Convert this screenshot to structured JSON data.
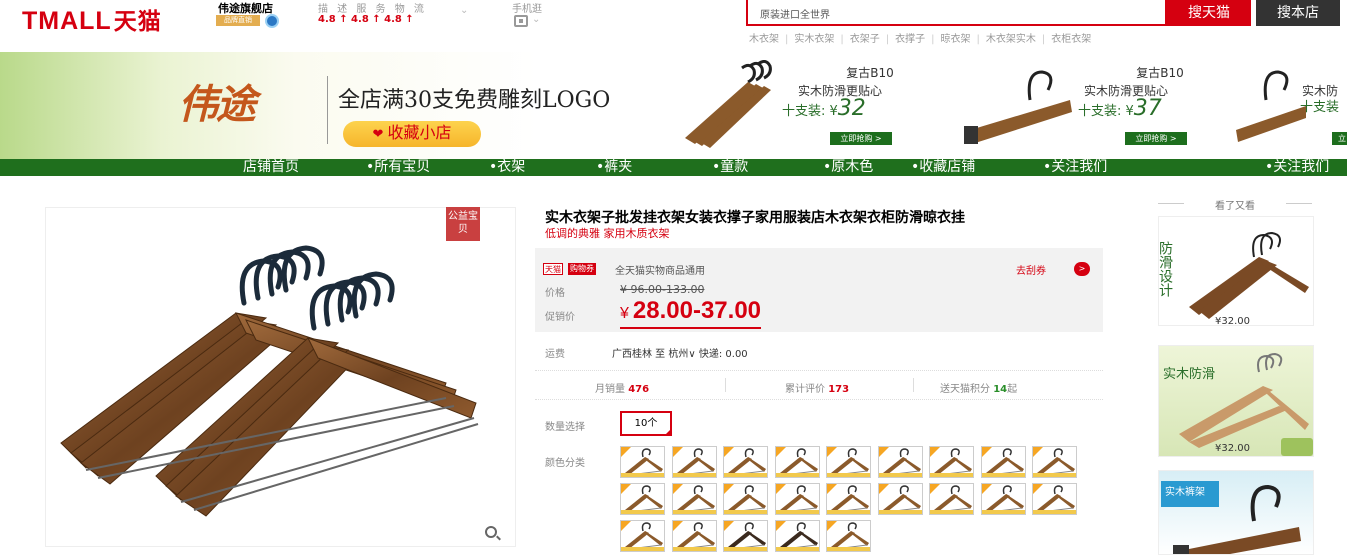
{
  "header": {
    "logo_latin": "TMALL",
    "logo_cn": "天猫",
    "shop_name": "伟途旗舰店",
    "shop_badge": "品牌直销",
    "rating_labels": "描 述  服 务  物 流",
    "rating_values": "4.8 ↑  4.8 ↑  4.8 ↑",
    "mobile_label": "手机逛",
    "search_placeholder": "原装进口全世界",
    "search_tmall_label": "搜天猫",
    "search_shop_label": "搜本店",
    "hot_words": [
      "木衣架",
      "实木衣架",
      "衣架子",
      "衣撑子",
      "晾衣架",
      "木衣架实木",
      "衣柜衣架"
    ]
  },
  "banner": {
    "brand": "伟途",
    "promo_text": "全店满30支免费雕刻LOGO",
    "favorite_label": "收藏小店",
    "cards": [
      {
        "title": "复古B10",
        "subtitle": "实木防滑更贴心",
        "price_prefix": "十支装: ¥",
        "price": "32",
        "buy": "立即抢购 >"
      },
      {
        "title": "复古B10",
        "subtitle": "实木防滑更贴心",
        "price_prefix": "十支装: ¥",
        "price": "37",
        "buy": "立即抢购 >"
      },
      {
        "title": "复",
        "subtitle": "实木防",
        "price_prefix": "十支装",
        "price": "",
        "buy": "立"
      }
    ]
  },
  "nav": {
    "items": [
      "店铺首页",
      "•所有宝贝",
      "•衣架",
      "•裤夹",
      "•童款",
      "•原木色",
      "•收藏店铺",
      "•关注我们",
      "•关注我们"
    ]
  },
  "product": {
    "welfare_tag": "公益宝贝",
    "title": "实木衣架子批发挂衣架女装衣撑子家用服装店木衣架衣柜防滑晾衣挂",
    "subtitle": "低调的典雅 家用木质衣架",
    "tag_tmall": "天猫",
    "tag_coupon": "购物券",
    "coupon_text": "全天猫实物商品通用",
    "coupon_link": "去刮券",
    "price_label": "价格",
    "original_price": "¥ 96.00-133.00",
    "promo_label": "促销价",
    "currency": "¥",
    "promo_price": "28.00-37.00",
    "ship_label": "运费",
    "ship_value": "广西桂林 至 杭州∨ 快递: 0.00",
    "monthly_sales_label": "月销量",
    "monthly_sales": "476",
    "reviews_label": "累计评价",
    "reviews": "173",
    "points_label": "送天猫积分",
    "points": "14",
    "points_suffix": "起",
    "qty_label": "数量选择",
    "qty_option": "10个",
    "color_label": "颜色分类",
    "color_swatch_count": 23
  },
  "sidebar": {
    "title": "看了又看",
    "items": [
      {
        "price": "¥32.00",
        "caption": "防滑设计"
      },
      {
        "price": "¥32.00",
        "caption": "实木防滑"
      },
      {
        "price": "",
        "caption": "实木裤架"
      }
    ]
  },
  "colors": {
    "tmall_red": "#d50010",
    "nav_green": "#1f6f1d",
    "wood_brown": "#8b5a2b"
  }
}
